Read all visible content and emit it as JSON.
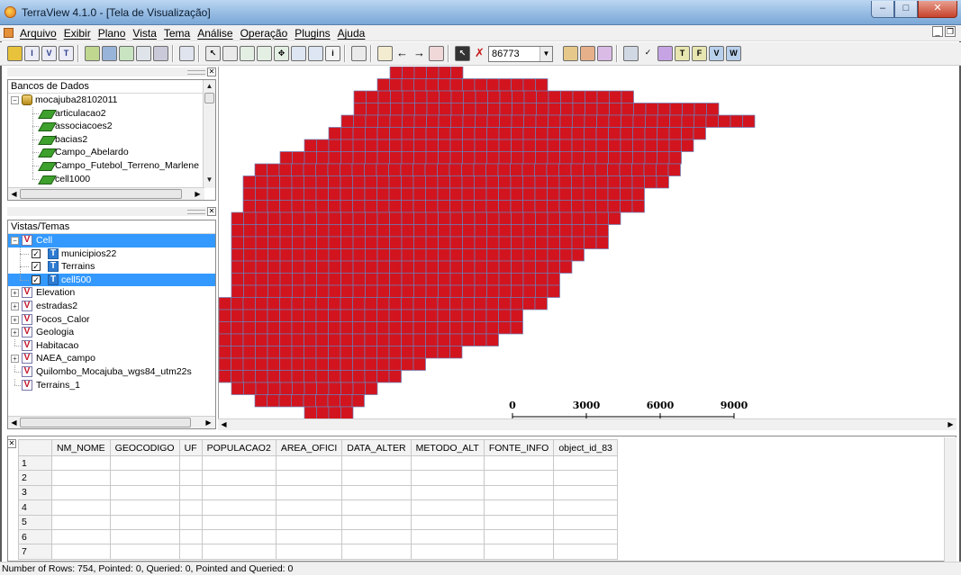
{
  "window": {
    "title": "TerraView 4.1.0 - [Tela de Visualização]"
  },
  "menus": [
    "Arquivo",
    "Exibir",
    "Plano",
    "Vista",
    "Tema",
    "Análise",
    "Operação",
    "Plugins",
    "Ajuda"
  ],
  "toolbar": {
    "scale_value": "86773"
  },
  "databases_panel": {
    "header": "Bancos de Dados",
    "root": "mocajuba28102011",
    "layers": [
      "articulacao2",
      "associacoes2",
      "bacias2",
      "Campo_Abelardo",
      "Campo_Futebol_Terreno_Marlene",
      "cell1000"
    ]
  },
  "views_panel": {
    "header": "Vistas/Temas",
    "expanded_view": "Cell",
    "themes": [
      {
        "label": "municipios22",
        "checked": true,
        "selected": false
      },
      {
        "label": "Terrains",
        "checked": true,
        "selected": false
      },
      {
        "label": "cell500",
        "checked": true,
        "selected": true
      }
    ],
    "views": [
      {
        "label": "Elevation",
        "expandable": true
      },
      {
        "label": "estradas2",
        "expandable": true
      },
      {
        "label": "Focos_Calor",
        "expandable": true
      },
      {
        "label": "Geologia",
        "expandable": true
      },
      {
        "label": "Habitacao",
        "expandable": false
      },
      {
        "label": "NAEA_campo",
        "expandable": true
      },
      {
        "label": "Quilombo_Mocajuba_wgs84_utm22s",
        "expandable": false
      },
      {
        "label": "Terrains_1",
        "expandable": false
      }
    ]
  },
  "map": {
    "fill_color": "#d2141e",
    "grid_color": "#6b7fb8",
    "scale_bar": {
      "labels": [
        "0",
        "3000",
        "6000",
        "9000"
      ]
    }
  },
  "table": {
    "columns": [
      "NM_NOME",
      "GEOCODIGO",
      "UF",
      "POPULACAO2",
      "AREA_OFICI",
      "DATA_ALTER",
      "METODO_ALT",
      "FONTE_INFO",
      "object_id_83"
    ],
    "row_numbers": [
      "1",
      "2",
      "3",
      "4",
      "5",
      "6",
      "7"
    ]
  },
  "status": "Number of Rows: 754, Pointed: 0, Queried: 0, Pointed and Queried: 0"
}
